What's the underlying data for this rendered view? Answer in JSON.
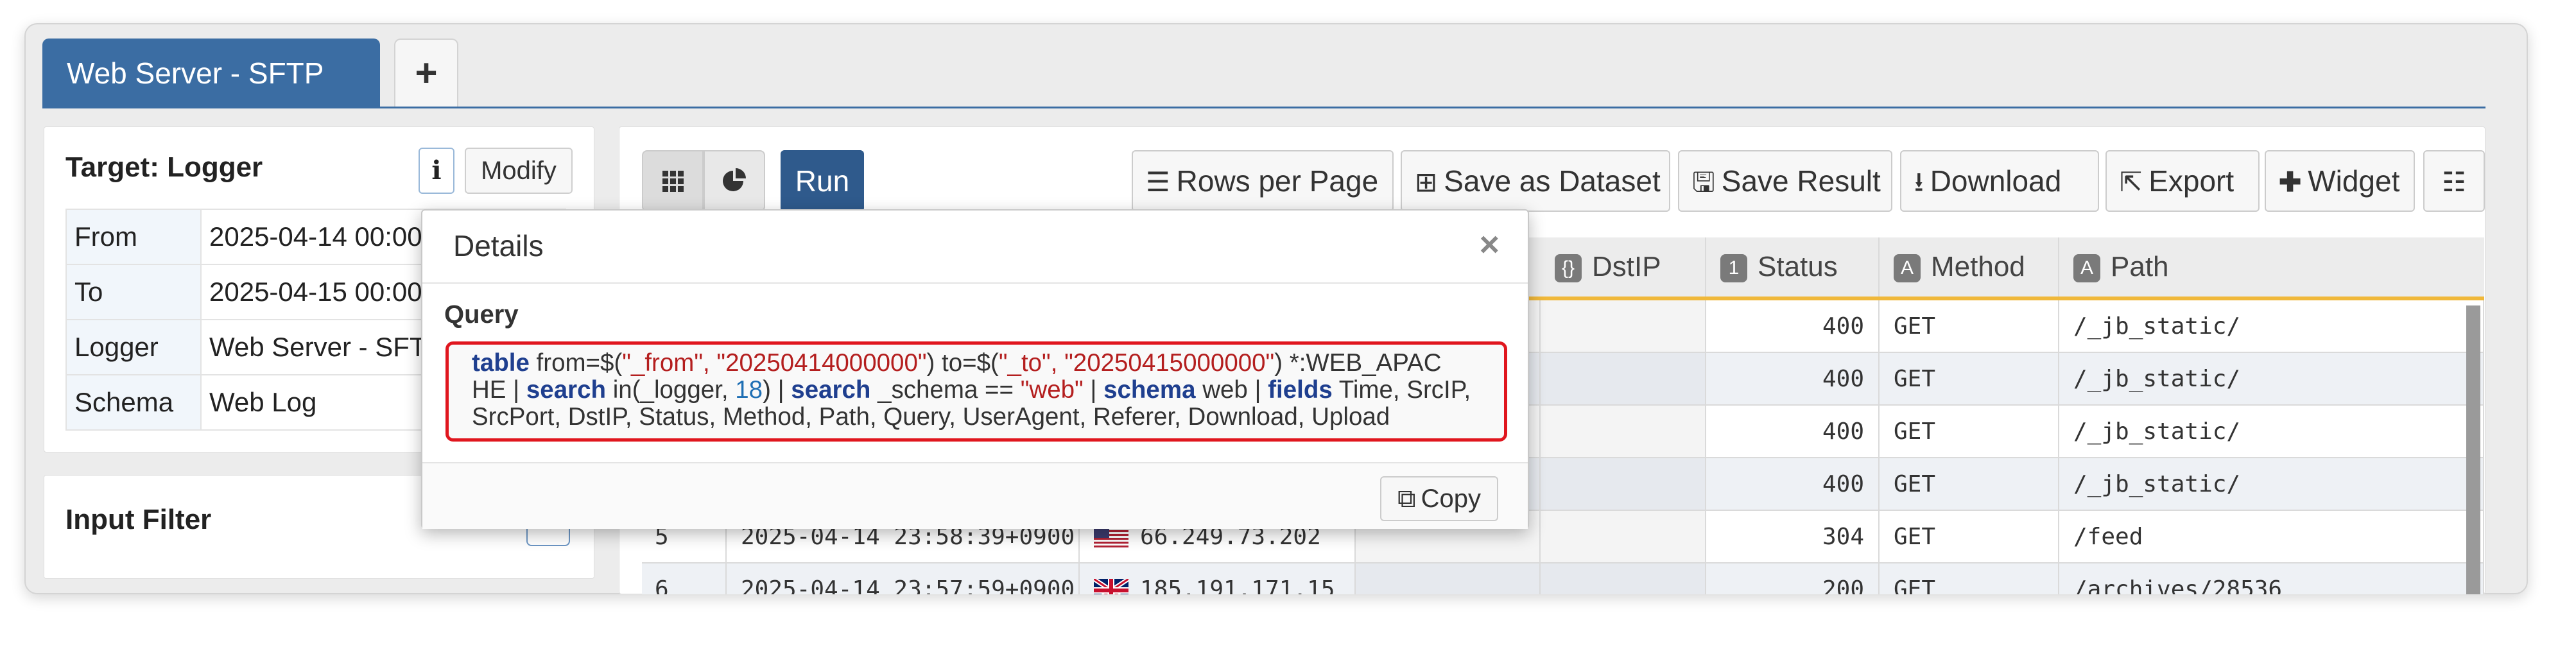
{
  "tabs": {
    "active_label": "Web Server - SFTP",
    "add_label": "+"
  },
  "target": {
    "title": "Target: Logger",
    "info_label": "i",
    "modify_label": "Modify",
    "rows": [
      {
        "key": "From",
        "value": "2025-04-14 00:00"
      },
      {
        "key": "To",
        "value": "2025-04-15 00:00"
      },
      {
        "key": "Logger",
        "value": "Web Server - SFTP"
      },
      {
        "key": "Schema",
        "value": "Web Log"
      }
    ]
  },
  "input_filter": {
    "title": "Input Filter"
  },
  "toolbar": {
    "run_label": "Run",
    "rows_per_page_label": "Rows per Page",
    "save_dataset_label": "Save as Dataset",
    "save_result_label": "Save Result",
    "download_label": "Download",
    "export_label": "Export",
    "widget_label": "Widget"
  },
  "grid": {
    "columns": [
      {
        "label": "DstIP",
        "type_badge": "{}"
      },
      {
        "label": "Status",
        "type_badge": "1"
      },
      {
        "label": "Method",
        "type_badge": "A"
      },
      {
        "label": "Path",
        "type_badge": "A"
      }
    ],
    "rows": [
      {
        "num": "",
        "time": "",
        "srcip": "",
        "dstip": "",
        "status": "400",
        "method": "GET",
        "path": "/_jb_static/"
      },
      {
        "num": "",
        "time": "",
        "srcip": "",
        "dstip": "",
        "status": "400",
        "method": "GET",
        "path": "/_jb_static/"
      },
      {
        "num": "",
        "time": "",
        "srcip": "",
        "dstip": "",
        "status": "400",
        "method": "GET",
        "path": "/_jb_static/"
      },
      {
        "num": "",
        "time": "",
        "srcip": "",
        "dstip": "",
        "status": "400",
        "method": "GET",
        "path": "/_jb_static/"
      },
      {
        "num": "5",
        "time": "2025-04-14 23:58:39+0900",
        "srcip": "66.249.73.202",
        "dstip": "",
        "status": "304",
        "method": "GET",
        "path": "/feed"
      },
      {
        "num": "6",
        "time": "2025-04-14 23:57:59+0900",
        "srcip": "185.191.171.15",
        "dstip": "",
        "status": "200",
        "method": "GET",
        "path": "/archives/28536"
      }
    ]
  },
  "details_modal": {
    "title": "Details",
    "close_label": "×",
    "query_label": "Query",
    "query_parts": {
      "p1": "table",
      "p2": " from=$(",
      "p3": "\"_from\", \"20250414000000\"",
      "p4": ") to=$(",
      "p5": "\"_to\", \"20250415000000\"",
      "p6": ") *:WEB_APAC",
      "p7": "HE | ",
      "p8": "search",
      "p9": " in(_logger, ",
      "p10": "18",
      "p11": ") | ",
      "p12": "search",
      "p13": " _schema == ",
      "p14": "\"web\"",
      "p15": " | ",
      "p16": "schema",
      "p17": " web | ",
      "p18": "fields",
      "p19": " Time, SrcIP,",
      "p20": "SrcPort, DstIP, Status, Method, Path, Query, UserAgent, Referer, Download, Upload"
    },
    "copy_label": "Copy"
  }
}
